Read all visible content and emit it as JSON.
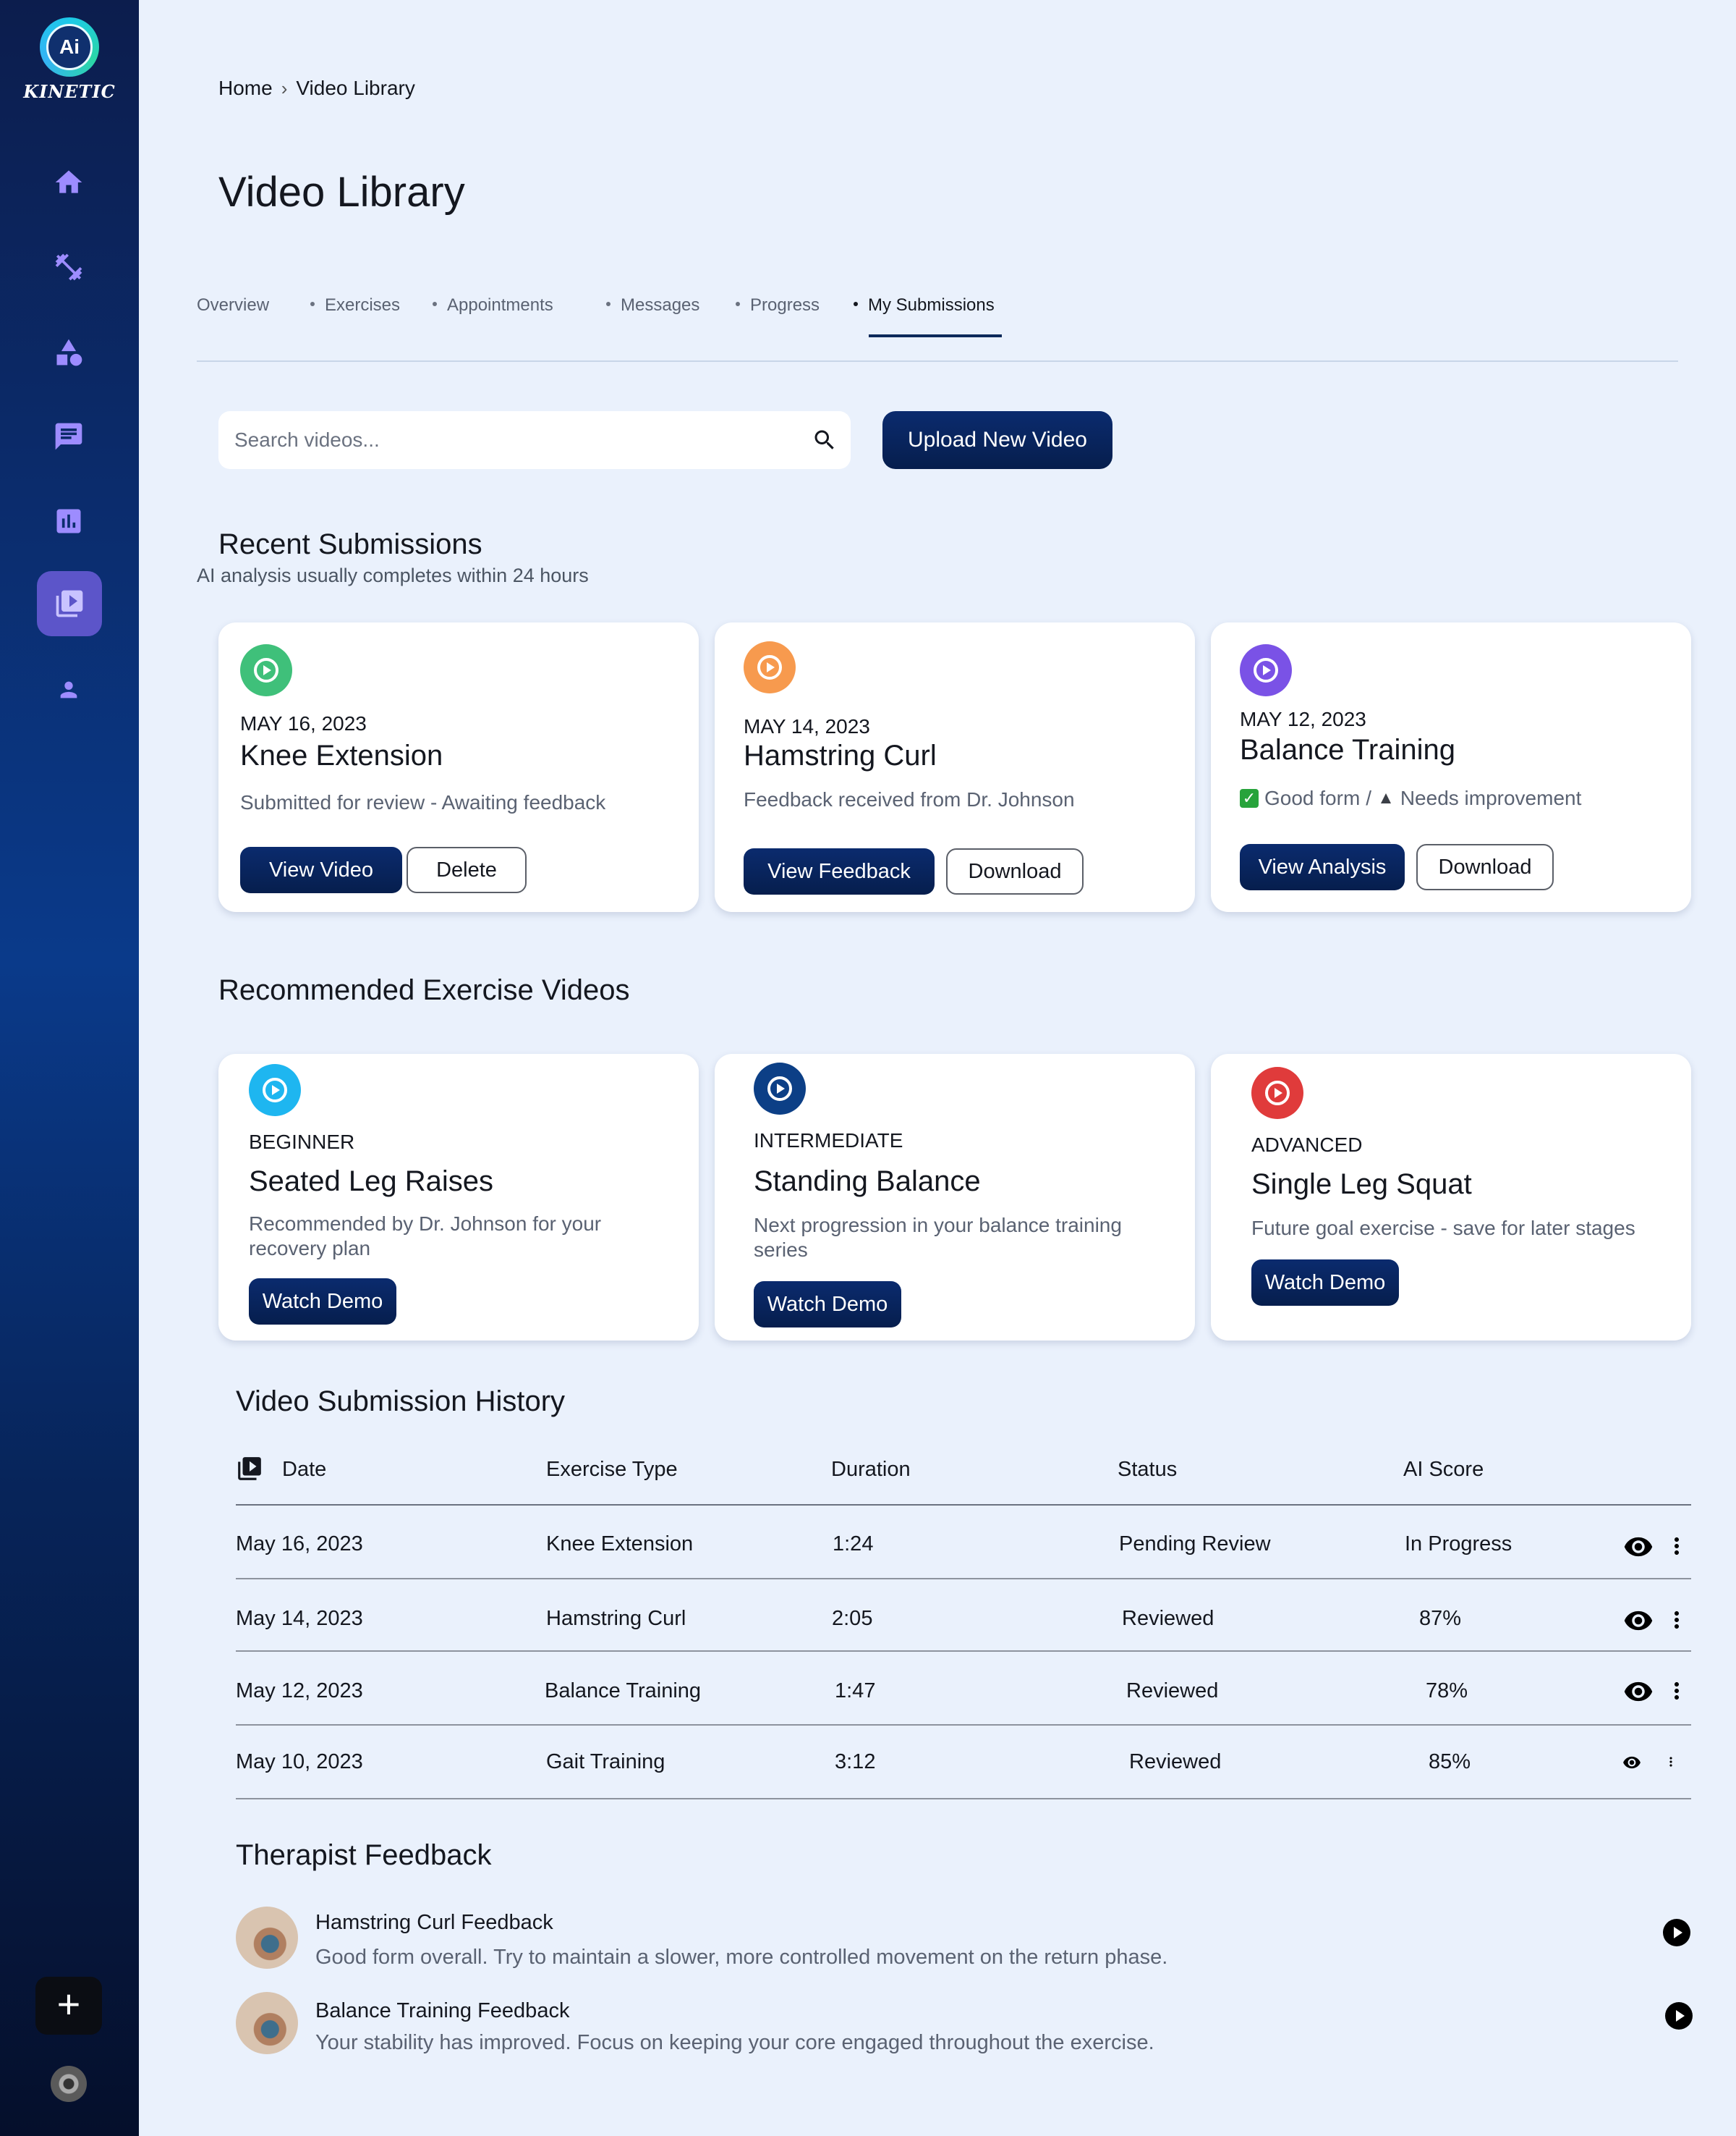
{
  "brand": {
    "logo_mark": "Ai",
    "logo_text": "KINETIC"
  },
  "sidebar": {
    "items": [
      {
        "icon": "home-icon"
      },
      {
        "icon": "dumbbell-icon"
      },
      {
        "icon": "shapes-icon"
      },
      {
        "icon": "chat-icon"
      },
      {
        "icon": "chart-icon"
      },
      {
        "icon": "video-library-icon",
        "active": true
      },
      {
        "icon": "person-icon"
      }
    ],
    "add_label": "+"
  },
  "breadcrumb": {
    "home": "Home",
    "separator": "›",
    "current": "Video Library"
  },
  "page_title": "Video Library",
  "tabs": [
    {
      "label": "Overview"
    },
    {
      "label": "Exercises"
    },
    {
      "label": "Appointments"
    },
    {
      "label": "Messages"
    },
    {
      "label": "Progress"
    },
    {
      "label": "My Submissions",
      "active": true
    }
  ],
  "search": {
    "placeholder": "Search videos..."
  },
  "upload_button": "Upload New Video",
  "recent": {
    "title": "Recent Submissions",
    "subtitle": "AI analysis usually completes within 24 hours",
    "cards": [
      {
        "color": "#3fc07a",
        "date": "MAY 16, 2023",
        "title": "Knee Extension",
        "desc": "Submitted for review - Awaiting feedback",
        "primary": "View Video",
        "secondary": "Delete"
      },
      {
        "color": "#f79a4e",
        "date": "MAY 14, 2023",
        "title": "Hamstring Curl",
        "desc": "Feedback received from Dr. Johnson",
        "primary": "View Feedback",
        "secondary": "Download"
      },
      {
        "color": "#7a52e6",
        "date": "MAY 12, 2023",
        "title": "Balance Training",
        "desc_good": "Good form",
        "desc_sep": "/",
        "desc_warn": "Needs improvement",
        "primary": "View Analysis",
        "secondary": "Download"
      }
    ]
  },
  "recommended": {
    "title": "Recommended Exercise Videos",
    "cards": [
      {
        "color": "#1eb6f0",
        "level": "BEGINNER",
        "title": "Seated Leg Raises",
        "desc": "Recommended by Dr. Johnson for your recovery plan",
        "button": "Watch Demo"
      },
      {
        "color": "#0c3f86",
        "level": "INTERMEDIATE",
        "title": "Standing Balance",
        "desc": "Next progression in your balance training series",
        "button": "Watch Demo"
      },
      {
        "color": "#e03b3b",
        "level": "ADVANCED",
        "title": "Single Leg Squat",
        "desc": "Future goal exercise - save for later stages",
        "button": "Watch Demo"
      }
    ]
  },
  "history": {
    "title": "Video Submission History",
    "columns": [
      "Date",
      "Exercise Type",
      "Duration",
      "Status",
      "AI Score"
    ],
    "rows": [
      {
        "date": "May 16, 2023",
        "exercise": "Knee Extension",
        "duration": "1:24",
        "status": "Pending Review",
        "score": "In Progress"
      },
      {
        "date": "May 14, 2023",
        "exercise": "Hamstring Curl",
        "duration": "2:05",
        "status": "Reviewed",
        "score": "87%"
      },
      {
        "date": "May 12, 2023",
        "exercise": "Balance Training",
        "duration": "1:47",
        "status": "Reviewed",
        "score": "78%"
      },
      {
        "date": "May 10, 2023",
        "exercise": "Gait Training",
        "duration": "3:12",
        "status": "Reviewed",
        "score": "85%"
      }
    ]
  },
  "feedback": {
    "title": "Therapist Feedback",
    "items": [
      {
        "title": "Hamstring Curl Feedback",
        "text": "Good form overall. Try to maintain a slower, more controlled movement on the return phase."
      },
      {
        "title": "Balance Training Feedback",
        "text": "Your stability has improved. Focus on keeping your core engaged throughout the exercise."
      }
    ]
  }
}
